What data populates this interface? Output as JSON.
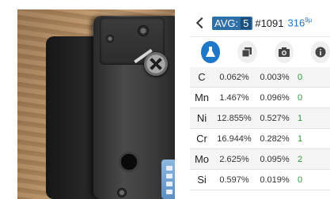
{
  "photo": {
    "alt": "Handheld analyzer device back view"
  },
  "header": {
    "avg_label": "AVG:",
    "avg_count": "5",
    "test_number": "#1091",
    "value": "316",
    "value_suffix": "9µ"
  },
  "tabs": [
    {
      "icon": "flask-icon",
      "active": true
    },
    {
      "icon": "copy-icon",
      "active": false
    },
    {
      "icon": "camera-icon",
      "active": false
    },
    {
      "icon": "info-icon",
      "active": false
    }
  ],
  "table": {
    "rows": [
      {
        "element": "C",
        "pct": "0.062%",
        "err": "0.003%",
        "partial": "0"
      },
      {
        "element": "Mn",
        "pct": "1.467%",
        "err": "0.096%",
        "partial": "0"
      },
      {
        "element": "Ni",
        "pct": "12.855%",
        "err": "0.527%",
        "partial": "1"
      },
      {
        "element": "Cr",
        "pct": "16.944%",
        "err": "0.282%",
        "partial": "1"
      },
      {
        "element": "Mo",
        "pct": "2.625%",
        "err": "0.095%",
        "partial": "2"
      },
      {
        "element": "Si",
        "pct": "0.597%",
        "err": "0.019%",
        "partial": "0"
      }
    ]
  },
  "colors": {
    "accent": "#1f77c8",
    "avg_bg": "#2f6fa7",
    "partial_green": "#2e9a3a"
  }
}
